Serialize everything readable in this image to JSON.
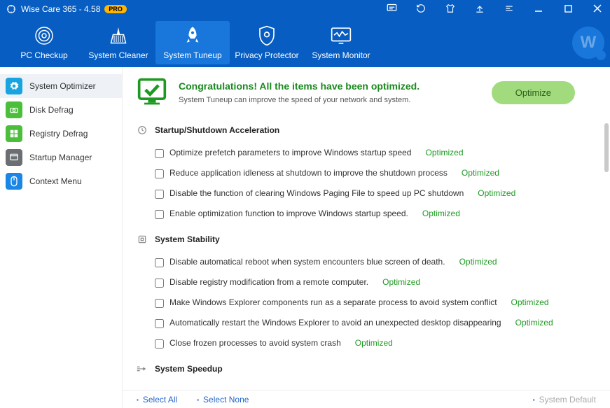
{
  "titlebar": {
    "title": "Wise Care 365 - 4.58",
    "badge": "PRO"
  },
  "toolbar": {
    "items": [
      {
        "label": "PC Checkup"
      },
      {
        "label": "System Cleaner"
      },
      {
        "label": "System Tuneup"
      },
      {
        "label": "Privacy Protector"
      },
      {
        "label": "System Monitor"
      }
    ]
  },
  "sidebar": {
    "items": [
      {
        "label": "System Optimizer",
        "color": "#18a4e0"
      },
      {
        "label": "Disk Defrag",
        "color": "#4bbf3a"
      },
      {
        "label": "Registry Defrag",
        "color": "#4bbf3a"
      },
      {
        "label": "Startup Manager",
        "color": "#6b6f73"
      },
      {
        "label": "Context Menu",
        "color": "#1a87e6"
      }
    ]
  },
  "header": {
    "title": "Congratulations! All the items have been optimized.",
    "sub": "System Tuneup can improve the speed of your network and system.",
    "btn": "Optimize"
  },
  "sections": [
    {
      "title": "Startup/Shutdown Acceleration",
      "items": [
        {
          "text": "Optimize prefetch parameters to improve Windows startup speed",
          "status": "Optimized"
        },
        {
          "text": "Reduce application idleness at shutdown to improve the shutdown process",
          "status": "Optimized"
        },
        {
          "text": "Disable the function of clearing Windows Paging File to speed up PC shutdown",
          "status": "Optimized"
        },
        {
          "text": "Enable optimization function to improve Windows startup speed.",
          "status": "Optimized"
        }
      ]
    },
    {
      "title": "System Stability",
      "items": [
        {
          "text": "Disable automatical reboot when system encounters blue screen of death.",
          "status": "Optimized"
        },
        {
          "text": "Disable registry modification from a remote computer.",
          "status": "Optimized"
        },
        {
          "text": "Make Windows Explorer components run as a separate process to avoid system conflict",
          "status": "Optimized"
        },
        {
          "text": "Automatically restart the Windows Explorer to avoid an unexpected desktop disappearing",
          "status": "Optimized"
        },
        {
          "text": "Close frozen processes to avoid system crash",
          "status": "Optimized"
        }
      ]
    },
    {
      "title": "System Speedup",
      "items": []
    }
  ],
  "footer": {
    "selectAll": "Select All",
    "selectNone": "Select None",
    "sysdefault": "System Default"
  }
}
